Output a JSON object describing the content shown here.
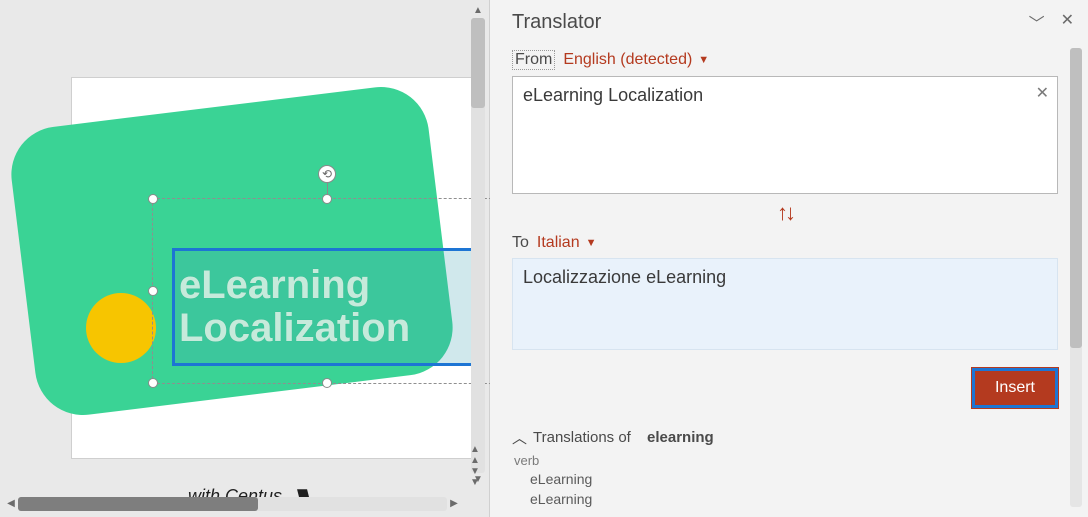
{
  "slide": {
    "title_line1": "eLearning",
    "title_line2": "Localization",
    "subtitle": "with Centus"
  },
  "translator": {
    "pane_title": "Translator",
    "from_label": "From",
    "from_lang": "English (detected)",
    "source_text": "eLearning Localization",
    "to_label": "To",
    "to_lang": "Italian",
    "target_text": "Localizzazione eLearning",
    "insert_label": "Insert",
    "dictionary": {
      "heading_prefix": "Translations of",
      "keyword": "elearning",
      "pos": "verb",
      "items": [
        "eLearning",
        "eLearning"
      ]
    }
  }
}
